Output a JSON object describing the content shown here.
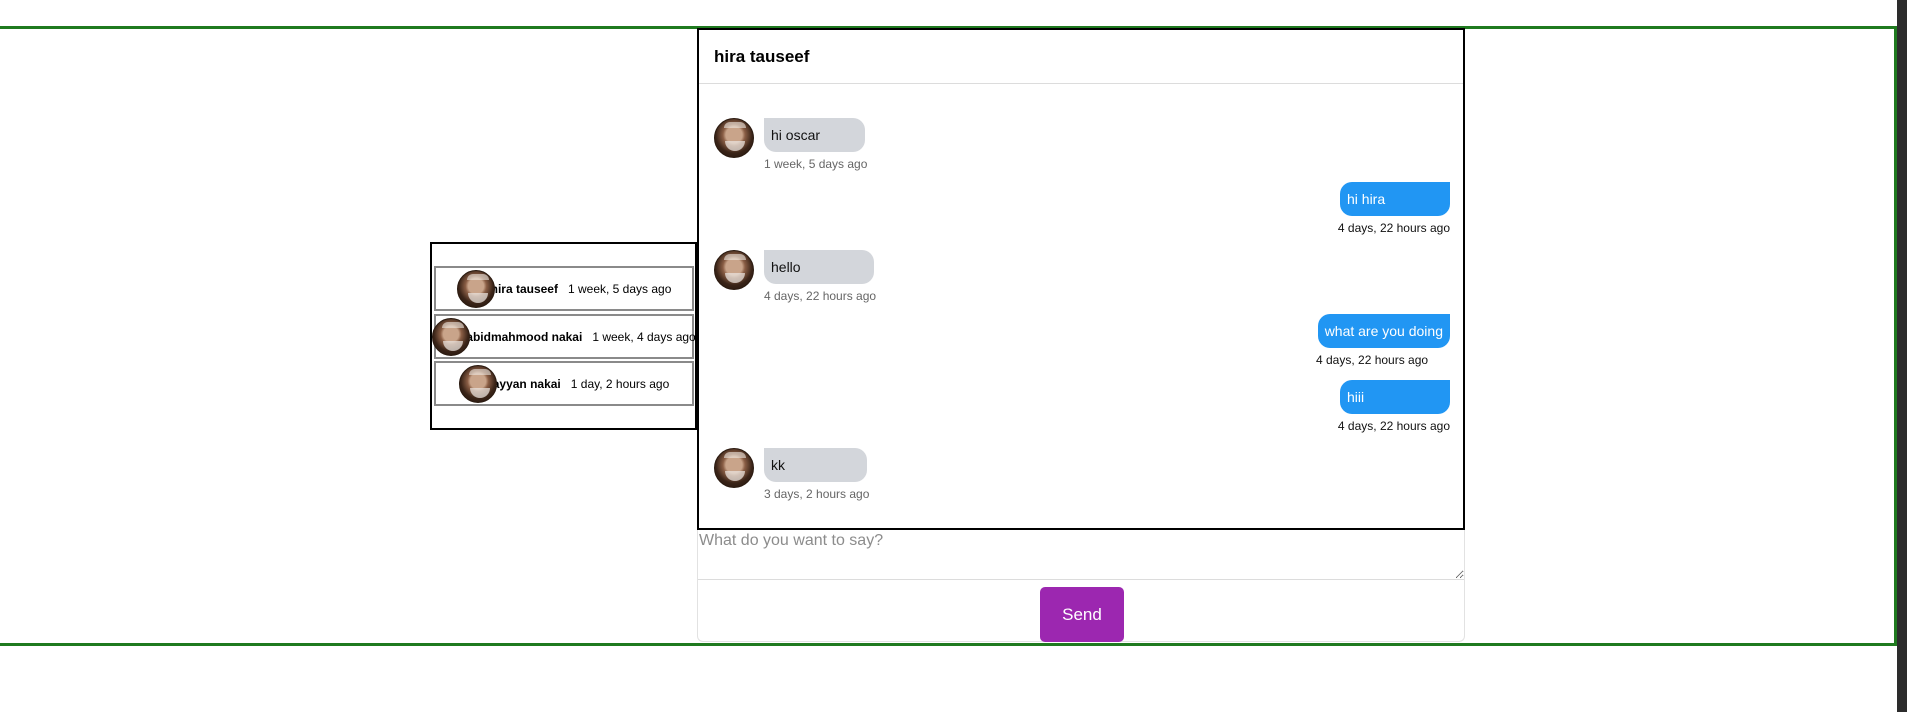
{
  "contacts": [
    {
      "name": "hira tauseef",
      "time": "1 week, 5 days ago"
    },
    {
      "name": "abidmahmood nakai",
      "time": "1 week, 4 days ago"
    },
    {
      "name": "ayyan nakai",
      "time": "1 day, 2 hours ago"
    }
  ],
  "chat": {
    "title": "hira tauseef",
    "messages": [
      {
        "direction": "incoming",
        "text": "hi oscar",
        "time": "1 week, 5 days ago"
      },
      {
        "direction": "outgoing",
        "text": "hi hira",
        "time": "4 days, 22 hours ago"
      },
      {
        "direction": "incoming",
        "text": "hello",
        "time": "4 days, 22 hours ago"
      },
      {
        "direction": "outgoing",
        "text": "what are you doing",
        "time": "4 days, 22 hours ago"
      },
      {
        "direction": "outgoing",
        "text": "hiii",
        "time": "4 days, 22 hours ago"
      },
      {
        "direction": "incoming",
        "text": "kk",
        "time": "3 days, 2 hours ago"
      }
    ]
  },
  "compose": {
    "placeholder": "What do you want to say?",
    "send_label": "Send"
  },
  "colors": {
    "frame_border": "#1f7a1f",
    "incoming_bubble": "#d3d6db",
    "outgoing_bubble": "#2196f3",
    "send_button": "#9c27b0"
  },
  "icons": {
    "avatar": "user-avatar-photo"
  }
}
